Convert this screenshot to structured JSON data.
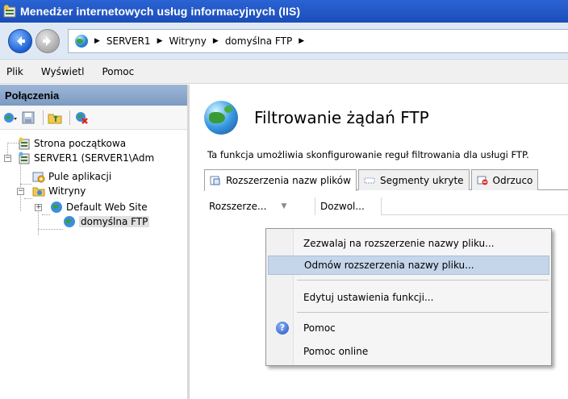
{
  "window": {
    "title": "Menedżer internetowych usług informacyjnych (IIS)"
  },
  "address": {
    "crumbs": [
      "SERVER1",
      "Witryny",
      "domyślna FTP"
    ]
  },
  "menu": {
    "items": [
      "Plik",
      "Wyświetl",
      "Pomoc"
    ]
  },
  "connections": {
    "header": "Połączenia",
    "tree": {
      "start_page": "Strona początkowa",
      "server": "SERVER1 (SERVER1\\Adm",
      "app_pools": "Pule aplikacji",
      "sites": "Witryny",
      "default_site": "Default Web Site",
      "ftp_site": "domyślna FTP"
    }
  },
  "feature": {
    "title": "Filtrowanie żądań FTP",
    "description": "Ta funkcja umożliwia skonfigurowanie reguł filtrowania dla usługi FTP.",
    "tabs": [
      "Rozszerzenia nazw plików",
      "Segmenty ukryte",
      "Odrzuco"
    ],
    "columns": [
      "Rozszerze...",
      "Dozwol..."
    ]
  },
  "context_menu": {
    "items": [
      "Zezwalaj na rozszerzenie nazwy pliku...",
      "Odmów rozszerzenia nazwy pliku...",
      "Edytuj ustawienia funkcji...",
      "Pomoc",
      "Pomoc online"
    ]
  },
  "colors": {
    "titlebar": "#1b4db8",
    "highlight": "#c5d5ea",
    "panel_header": "#7c9ac2"
  }
}
